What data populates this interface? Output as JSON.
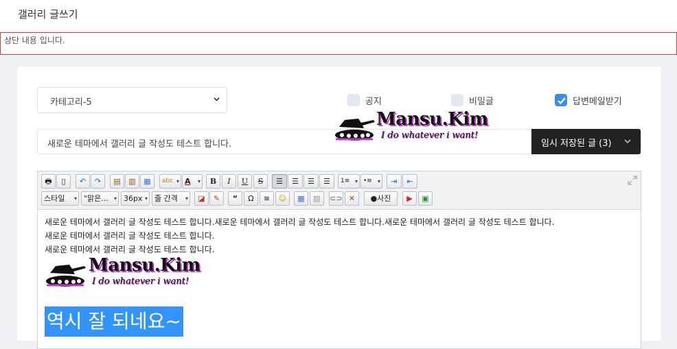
{
  "page": {
    "title": "갤러리 글쓰기",
    "notice": "상단 내용 입니다."
  },
  "form": {
    "category": {
      "value": "카테고리-5"
    },
    "checks": [
      {
        "label": "공지",
        "checked": false
      },
      {
        "label": "비밀글",
        "checked": false
      },
      {
        "label": "답변메일받기",
        "checked": true
      }
    ],
    "subject": {
      "value": "새로운 테마에서 갤러리 글 작성도 테스트 합니다."
    },
    "temp_saved": "임시 저장된 글 (3)"
  },
  "logo": {
    "name": "Mansu.Kim",
    "tagline": "I do whatever i want!"
  },
  "toolbar": {
    "style": "스타일",
    "font": "\"맑은...",
    "size": "36px",
    "line": "줄 간격",
    "photo": "사진"
  },
  "content": {
    "lines": [
      "새로운 테마에서 갤러리 글 작성도 테스트 합니다.새로운 테마에서 갤러리 글 작성도 테스트 합니다.새로운 테마에서 갤러리 글 작성도 테스트 합니다.",
      "새로운 테마에서 갤러리 글 작성도 테스트 합니다.",
      "새로운 테마에서 갤러리 글 작성도 테스트 합니다."
    ],
    "highlight": "역시 잘 되네요~"
  },
  "colors": {
    "accent": "#3b8fe0",
    "dark_button": "#222222",
    "notice_border": "#e13b3b",
    "highlight": "#3294ff"
  }
}
